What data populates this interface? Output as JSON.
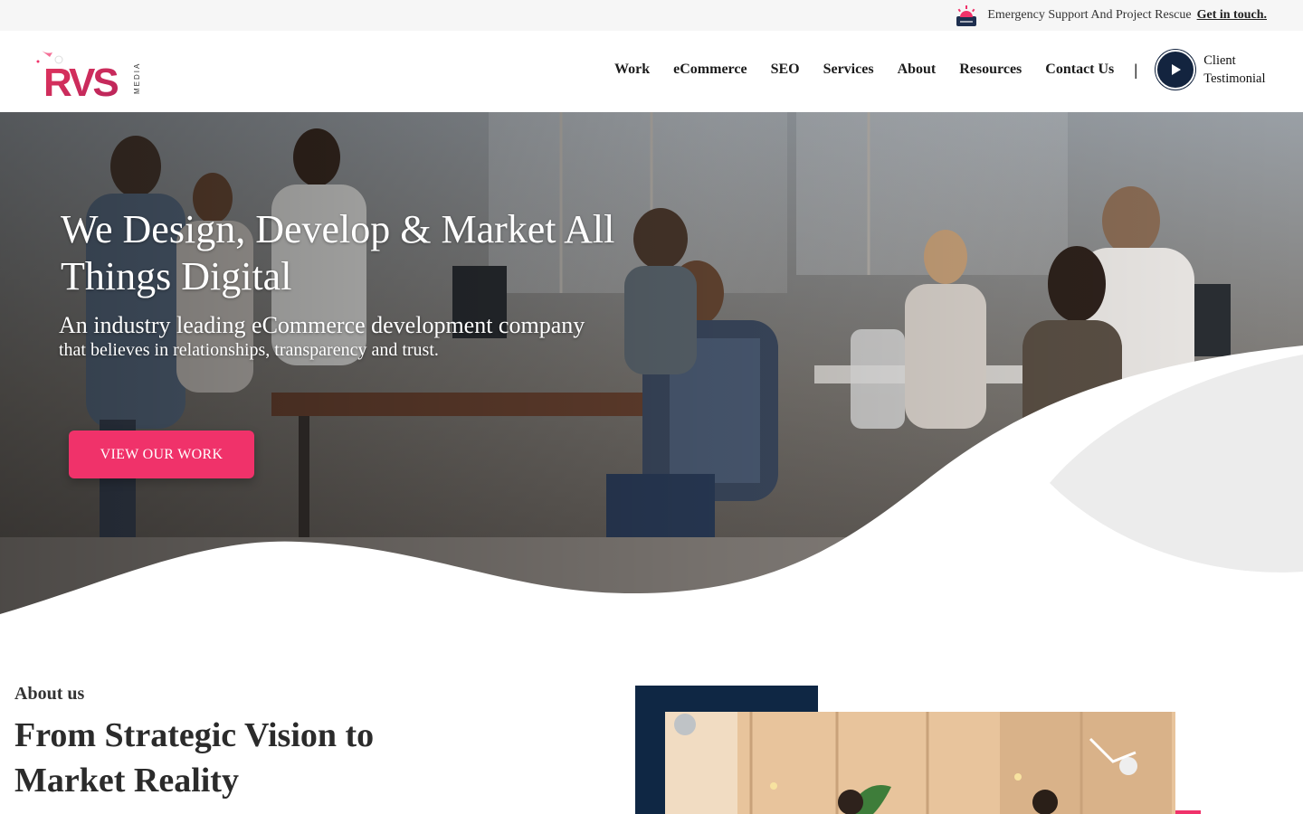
{
  "topbar": {
    "icon": "alarm-siren-icon",
    "text": "Emergency Support And Project Rescue",
    "link": "Get in touch."
  },
  "brand": {
    "logo_text": "RVS",
    "logo_sub": "MEDIA",
    "accent_color": "#f0326a",
    "navy_color": "#13243f"
  },
  "nav": {
    "items": [
      "Work",
      "eCommerce",
      "SEO",
      "Services",
      "About",
      "Resources",
      "Contact Us"
    ],
    "separator": "|",
    "testimonial_line1": "Client",
    "testimonial_line2": "Testimonial",
    "testimonial_icon": "play-icon"
  },
  "hero": {
    "title": "We Design, Develop & Market All Things Digital",
    "subtitle_big": "An industry leading eCommerce development company",
    "subtitle_small": "that believes in relationships, transparency and trust.",
    "cta": "VIEW OUR WORK"
  },
  "about": {
    "eyebrow": "About us",
    "title": "From Strategic Vision to Market Reality"
  }
}
